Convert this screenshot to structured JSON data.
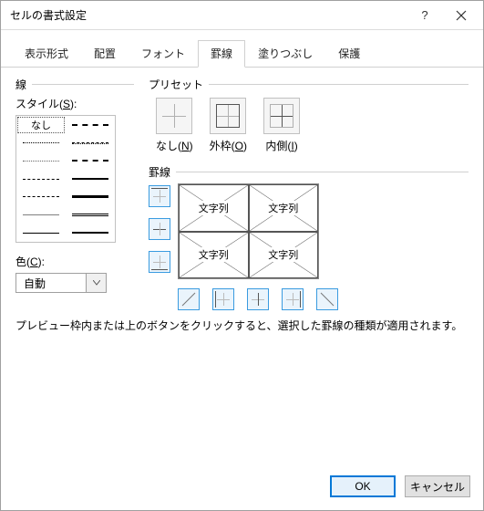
{
  "title": "セルの書式設定",
  "tabs": {
    "display": "表示形式",
    "align": "配置",
    "font": "フォント",
    "border": "罫線",
    "fill": "塗りつぶし",
    "protect": "保護"
  },
  "active_tab": "border",
  "left": {
    "group_line": "線",
    "style_label": "スタイル(S):",
    "none_label": "なし",
    "color_label": "色(C):",
    "color_value": "自動"
  },
  "right": {
    "preset_group": "プリセット",
    "preset_none": "なし(N)",
    "preset_outside": "外枠(O)",
    "preset_inside": "内側(I)",
    "border_group": "罫線",
    "cell_text": "文字列"
  },
  "hint": "プレビュー枠内または上のボタンをクリックすると、選択した罫線の種類が適用されます。",
  "buttons": {
    "ok": "OK",
    "cancel": "キャンセル"
  }
}
